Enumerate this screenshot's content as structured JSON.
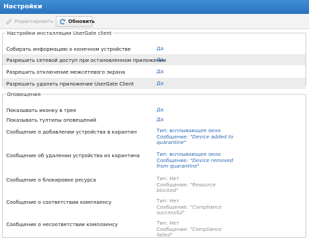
{
  "window": {
    "title": "Настройки"
  },
  "toolbar": {
    "edit_label": "Редактировать",
    "refresh_label": "Обновить"
  },
  "install_settings": {
    "legend": "Настройки инсталляции UserGate client",
    "rows": [
      {
        "label": "Собирать информацию о конечном устройстве",
        "value": "Да"
      },
      {
        "label": "Разрешить сетевой доступ при остановленном приложении",
        "value": "Да"
      },
      {
        "label": "Разрешить отключение межсетевого экрана",
        "value": "Да"
      },
      {
        "label": "Разрешить удалять приложение UserGate Client",
        "value": "Да"
      }
    ]
  },
  "alerts": {
    "legend": "Оповещения",
    "rows": [
      {
        "label": "Показывать иконку в трее",
        "value": "Да"
      },
      {
        "label": "Показывать тултипы оповещений",
        "value": "Да"
      },
      {
        "label": "Сообщение о добавлении устройства в карантин",
        "type": "Тип: всплывающее окно",
        "msg_prefix": "Сообщение: ",
        "msg_line1": "\"Device added to",
        "msg_line2": "quarantine\""
      },
      {
        "label": "Сообщение об удалении устройства из карантина",
        "type": "Тип: всплывающее окно",
        "msg_prefix": "Сообщение: ",
        "msg_line1": "\"Device removed",
        "msg_line2": "from quarantine\""
      },
      {
        "label": "Сообщение о блокировке ресурса",
        "type": "Тип: Нет",
        "msg_prefix": "Сообщение: ",
        "msg_line1": "\"Resource",
        "msg_line2": "blocked\""
      },
      {
        "label": "Сообщение о соответствии комплаенсу",
        "type": "Тип: Нет",
        "msg_prefix": "Сообщение: ",
        "msg_line1": "\"Compliance",
        "msg_line2": "successful\""
      },
      {
        "label": "Сообщение о несоответствии комплаенсу",
        "type": "Тип: Нет",
        "msg_prefix": "Сообщение: ",
        "msg_line1": "\"Compliance",
        "msg_line2": "failed\""
      }
    ]
  },
  "colors": {
    "title_bar": "#2f7cc8",
    "value_blue": "#2f6bb6",
    "value_gray": "#8c8c8c",
    "row_alt": "#ececec"
  }
}
